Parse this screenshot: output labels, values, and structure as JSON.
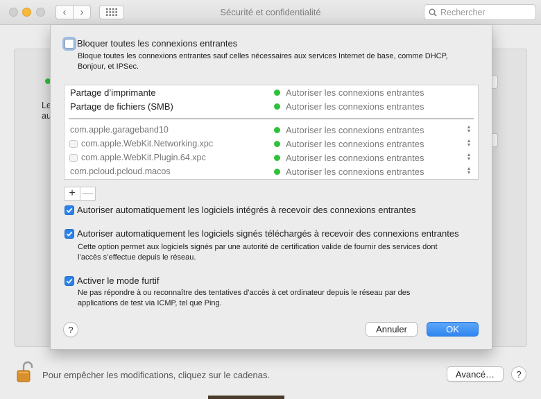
{
  "window": {
    "title": "Sécurité et confidentialité",
    "search_placeholder": "Rechercher"
  },
  "toolbar": {
    "back_glyph": "‹",
    "forward_glyph": "›",
    "icons": [
      "back-chevron-icon",
      "forward-chevron-icon",
      "grid-icon",
      "search-icon"
    ]
  },
  "background": {
    "text_line1": "Le",
    "text_line2": "au",
    "lock_text": "Pour empêcher les modifications, cliquez sur le cadenas.",
    "advanced_button": "Avancé…",
    "help_glyph": "?"
  },
  "sheet": {
    "block_all": {
      "checked": false,
      "label": "Bloquer toutes les connexions entrantes",
      "description_line1": "Bloque toutes les connexions entrantes sauf celles nécessaires aux services Internet de base, comme DHCP,",
      "description_line2": "Bonjour, et IPSec."
    },
    "services": [
      {
        "name": "Partage d’imprimante",
        "status": "Autoriser les connexions entrantes"
      },
      {
        "name": "Partage de fichiers (SMB)",
        "status": "Autoriser les connexions entrantes"
      }
    ],
    "apps": [
      {
        "name": "com.apple.garageband10",
        "status": "Autoriser les connexions entrantes",
        "has_icon": false
      },
      {
        "name": "com.apple.WebKit.Networking.xpc",
        "status": "Autoriser les connexions entrantes",
        "has_icon": true
      },
      {
        "name": "com.apple.WebKit.Plugin.64.xpc",
        "status": "Autoriser les connexions entrantes",
        "has_icon": true
      },
      {
        "name": "com.pcloud.pcloud.macos",
        "status": "Autoriser les connexions entrantes",
        "has_icon": false
      }
    ],
    "add_glyph": "+",
    "remove_glyph": "—",
    "stepper_glyph": "◇",
    "auto_builtin": {
      "checked": true,
      "label": "Autoriser automatiquement les logiciels intégrés à recevoir des connexions entrantes"
    },
    "auto_signed": {
      "checked": true,
      "label": "Autoriser automatiquement les logiciels signés téléchargés à recevoir des connexions entrantes",
      "description_line1": "Cette option permet aux logiciels signés par une autorité de certification valide de fournir des services dont",
      "description_line2": "l’accès s’effectue depuis le réseau."
    },
    "stealth": {
      "checked": true,
      "label": "Activer le mode furtif",
      "description_line1": "Ne pas répondre à ou reconnaître des tentatives d’accès à cet ordinateur depuis le réseau par des",
      "description_line2": "applications de test via ICMP, tel que Ping."
    },
    "help_glyph": "?",
    "cancel_button": "Annuler",
    "ok_button": "OK"
  },
  "colors": {
    "accent": "#2b82e8",
    "status_green": "#2fc13a",
    "traffic_yellow": "#f6b93b"
  }
}
